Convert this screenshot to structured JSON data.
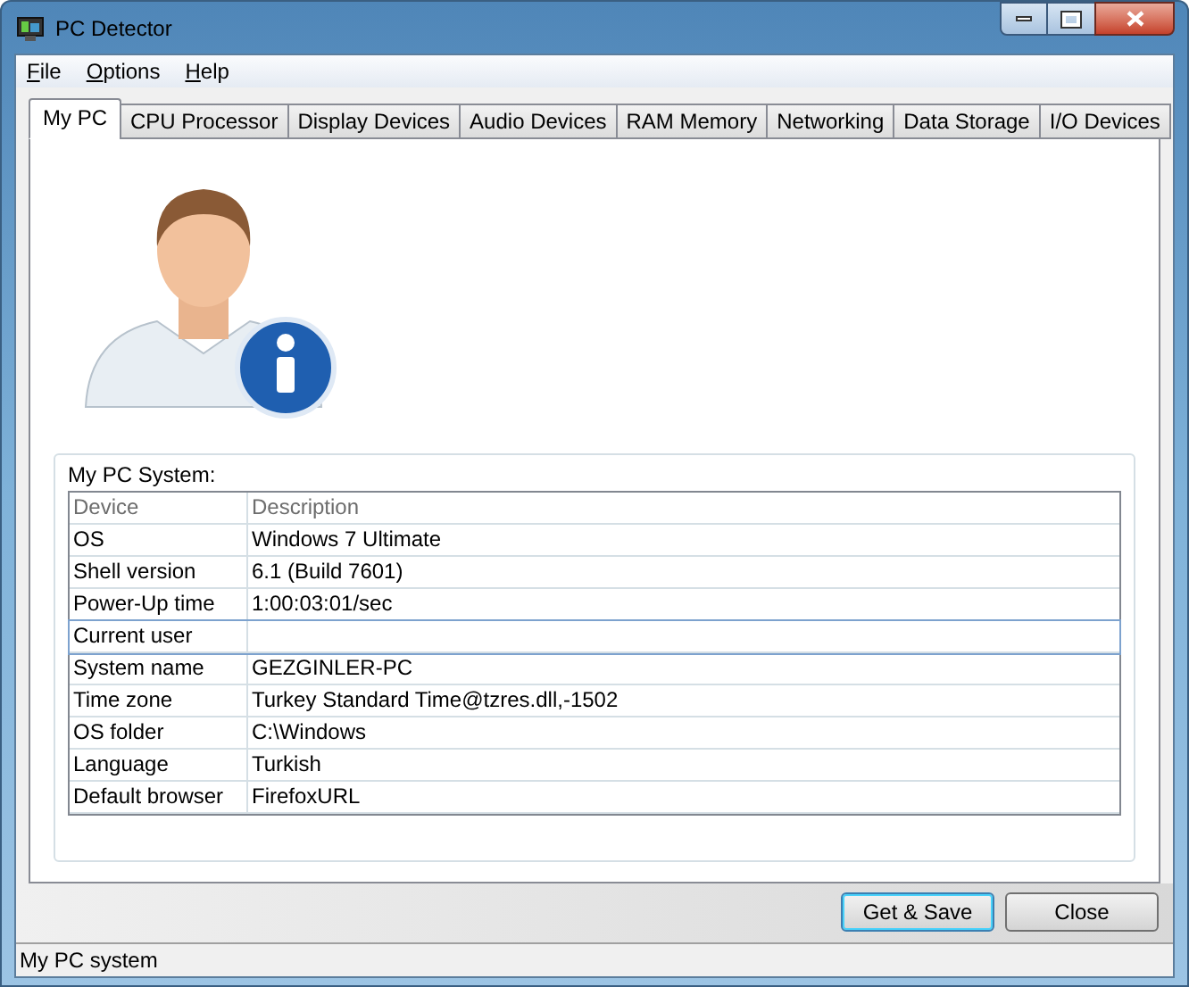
{
  "window": {
    "title": "PC Detector"
  },
  "menu": [
    {
      "label": "File"
    },
    {
      "label": "Options"
    },
    {
      "label": "Help"
    }
  ],
  "tabs": [
    {
      "label": "My PC",
      "selected": true
    },
    {
      "label": "CPU Processor",
      "selected": false
    },
    {
      "label": "Display Devices",
      "selected": false
    },
    {
      "label": "Audio Devices",
      "selected": false
    },
    {
      "label": "RAM Memory",
      "selected": false
    },
    {
      "label": "Networking",
      "selected": false
    },
    {
      "label": "Data Storage",
      "selected": false
    },
    {
      "label": "I/O Devices",
      "selected": false
    }
  ],
  "system": {
    "title": "My PC System:",
    "columns": [
      "Device",
      "Description"
    ],
    "rows": [
      {
        "device": "OS",
        "description": "Windows 7 Ultimate",
        "selected": false
      },
      {
        "device": "Shell version",
        "description": "6.1 (Build 7601)",
        "selected": false
      },
      {
        "device": "Power-Up time",
        "description": "1:00:03:01/sec",
        "selected": false
      },
      {
        "device": "Current user",
        "selected": true
      },
      {
        "device": "System name",
        "description": "GEZGINLER-PC",
        "selected": false
      },
      {
        "device": "Time zone",
        "description": "Turkey Standard Time@tzres.dll,-1502",
        "selected": false
      },
      {
        "device": "OS folder",
        "description": "C:\\Windows",
        "selected": false
      },
      {
        "device": "Language",
        "description": "Turkish",
        "selected": false
      },
      {
        "device": "Default browser",
        "description": "FirefoxURL",
        "selected": false
      }
    ]
  },
  "buttons": [
    {
      "label": "Get & Save",
      "default": true
    },
    {
      "label": "Close",
      "default": false
    }
  ],
  "status_bar": "My PC system"
}
